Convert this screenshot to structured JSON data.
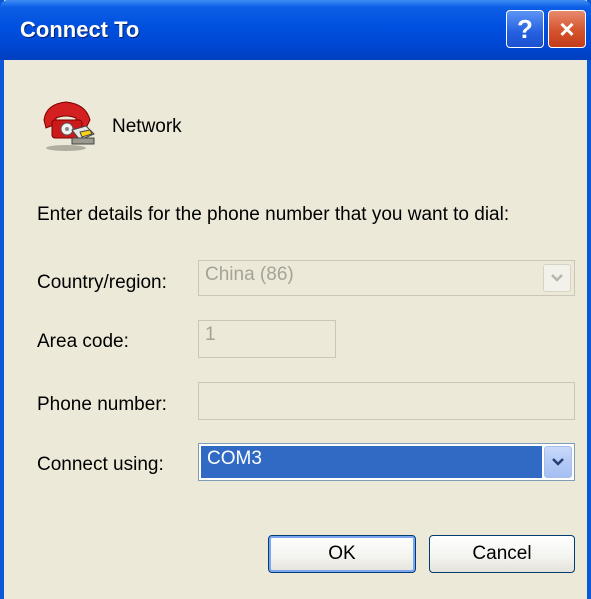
{
  "window": {
    "title": "Connect To"
  },
  "title_buttons": {
    "help": "?",
    "close": "×"
  },
  "connection": {
    "name": "Network",
    "icon": "phone-icon"
  },
  "instructions": "Enter details for the phone number that you want to dial:",
  "form": {
    "country": {
      "label": "Country/region:",
      "value": "China (86)"
    },
    "area_code": {
      "label": "Area code:",
      "value": "1"
    },
    "phone_number": {
      "label": "Phone number:",
      "value": ""
    },
    "connect_using": {
      "label": "Connect using:",
      "value": "COM3"
    }
  },
  "buttons": {
    "ok": "OK",
    "cancel": "Cancel"
  },
  "colors": {
    "titlebar": "#0050e0",
    "selection": "#316ac5",
    "dialog_bg": "#ece9d8",
    "close": "#d4532c"
  }
}
